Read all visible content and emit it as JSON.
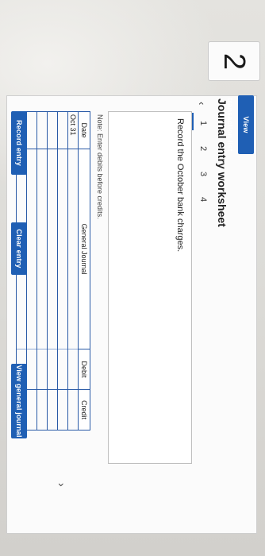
{
  "question_number": "2",
  "header": {
    "view_transaction_list": "View transaction list"
  },
  "worksheet": {
    "title": "Journal entry worksheet",
    "prev_icon": "chevron-left-icon",
    "next_icon": "chevron-right-icon",
    "tabs": [
      "1",
      "2",
      "3",
      "4"
    ],
    "active_tab": "1",
    "instruction": "Record the October bank charges.",
    "note": "Note: Enter debits before credits."
  },
  "table": {
    "columns": [
      "Date",
      "General Journal",
      "Debit",
      "Credit"
    ],
    "rows": [
      [
        "Oct 31",
        "",
        "",
        ""
      ],
      [
        "",
        "",
        "",
        ""
      ],
      [
        "",
        "",
        "",
        ""
      ],
      [
        "",
        "",
        "",
        ""
      ],
      [
        "",
        "",
        "",
        ""
      ],
      [
        "",
        "",
        "",
        ""
      ]
    ]
  },
  "buttons": {
    "record": "Record entry",
    "clear": "Clear entry",
    "view_journal": "View general journal"
  },
  "colors": {
    "accent": "#1f5fb4",
    "grid": "#2a5aa6"
  }
}
